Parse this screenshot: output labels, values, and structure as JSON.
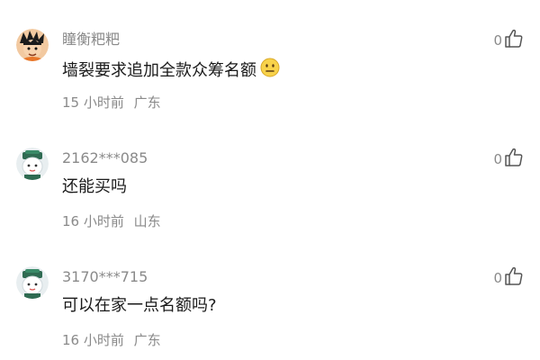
{
  "comments": [
    {
      "username": "瞳衡粑粑",
      "content": "墙裂要求追加全款众筹名额",
      "emoji": "neutral-face-emoji",
      "time": "15 小时前",
      "location": "广东",
      "likes": "0",
      "avatar": "cartoon-character-avatar"
    },
    {
      "username": "2162***085",
      "content": "还能买吗",
      "time": "16 小时前",
      "location": "山东",
      "likes": "0",
      "avatar": "default-mascot-avatar"
    },
    {
      "username": "3170***715",
      "content": "可以在家一点名额吗?",
      "time": "16 小时前",
      "location": "广东",
      "likes": "0",
      "avatar": "default-mascot-avatar"
    }
  ],
  "colors": {
    "secondary_text": "#8a8a8a",
    "primary_text": "#1a1a1a",
    "background": "#ffffff"
  }
}
